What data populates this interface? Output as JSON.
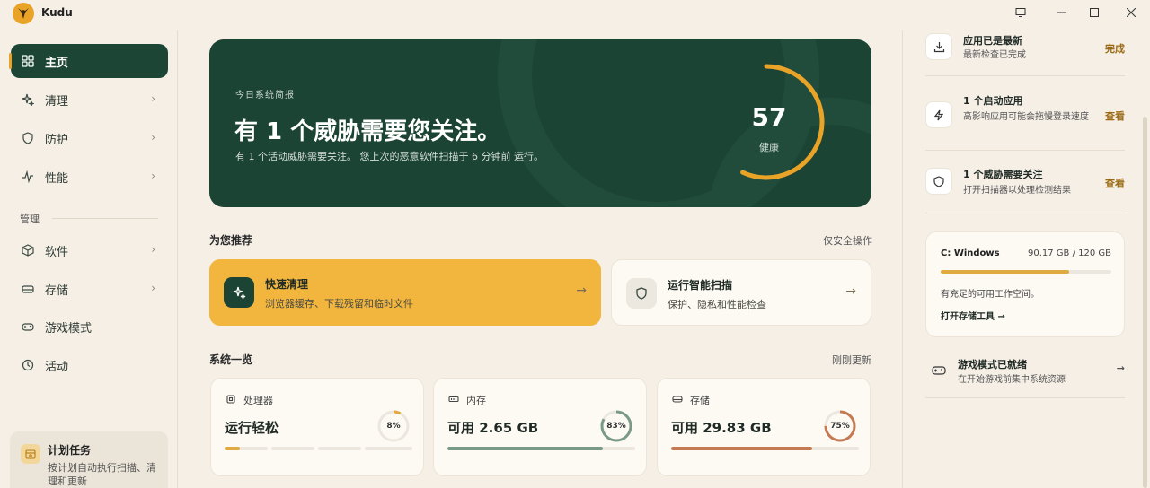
{
  "app": {
    "title": "Kudu"
  },
  "sidebar": {
    "items": [
      {
        "label": "主页",
        "icon": "grid-icon",
        "active": true
      },
      {
        "label": "清理",
        "icon": "sparkle-icon"
      },
      {
        "label": "防护",
        "icon": "shield-icon"
      },
      {
        "label": "性能",
        "icon": "pulse-icon"
      }
    ],
    "section_label": "管理",
    "manage_items": [
      {
        "label": "软件",
        "icon": "box-icon"
      },
      {
        "label": "存储",
        "icon": "drive-icon"
      },
      {
        "label": "游戏模式",
        "icon": "gamepad-icon"
      },
      {
        "label": "活动",
        "icon": "history-icon"
      }
    ],
    "task": {
      "title": "计划任务",
      "desc_line1": "按计划自动执行扫描、清",
      "desc_line2": "理和更新"
    }
  },
  "hero": {
    "eyebrow": "今日系统简报",
    "title": "有 1 个威胁需要您关注。",
    "subtitle": "有 1 个活动威胁需要关注。 您上次的恶意软件扫描于 6 分钟前 运行。",
    "score": "57",
    "score_label": "健康",
    "score_fraction": 0.57
  },
  "recommend": {
    "title": "为您推荐",
    "right": "仅安全操作",
    "clean": {
      "title": "快速清理",
      "desc": "浏览器缓存、下载残留和临时文件",
      "arrow": "→"
    },
    "scan": {
      "title": "运行智能扫描",
      "desc": "保护、隐私和性能检查",
      "arrow": "→"
    }
  },
  "overview": {
    "title": "系统一览",
    "right": "刚刚更新",
    "cpu": {
      "label": "处理器",
      "value": "运行轻松",
      "pct": "8%",
      "fraction": 0.08,
      "color": "#e0aa42"
    },
    "mem": {
      "label": "内存",
      "value": "可用 2.65 GB",
      "pct": "83%",
      "fraction": 0.83,
      "color": "#7a9a88"
    },
    "disk": {
      "label": "存储",
      "value": "可用 29.83 GB",
      "pct": "75%",
      "fraction": 0.75,
      "color": "#c47a52"
    }
  },
  "right_panel": {
    "update": {
      "title": "应用已是最新",
      "desc": "最新检查已完成",
      "action": "完成"
    },
    "startup": {
      "title": "1 个启动应用",
      "desc": "高影响应用可能会拖慢登录速度",
      "action": "查看"
    },
    "threat": {
      "title": "1 个威胁需要关注",
      "desc": "打开扫描器以处理检测结果",
      "action": "查看"
    },
    "drive": {
      "name": "C: Windows",
      "size": "90.17 GB / 120 GB",
      "fraction": 0.7514,
      "desc": "有充足的可用工作空间。",
      "link": "打开存储工具 →"
    },
    "game": {
      "title": "游戏模式已就绪",
      "desc": "在开始游戏前集中系统资源",
      "arrow": "→"
    }
  },
  "colors": {
    "accent": "#e9a428",
    "brand": "#1c4435"
  }
}
